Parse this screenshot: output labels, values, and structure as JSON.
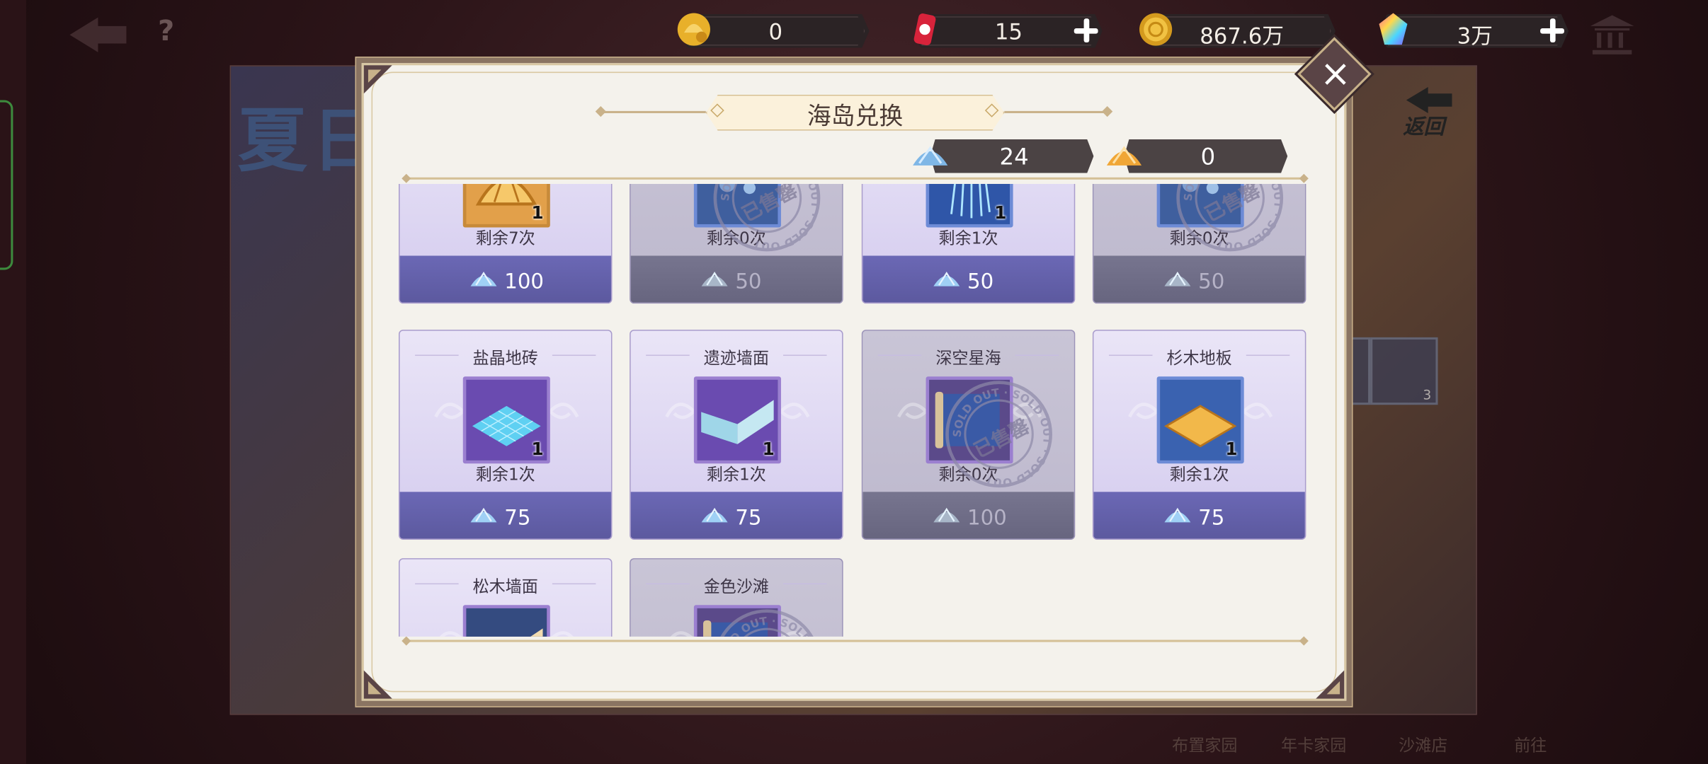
{
  "resources": [
    {
      "name": "golden-shell-currency",
      "value": "0",
      "plus": false
    },
    {
      "name": "energy-can",
      "value": "15",
      "plus": true
    },
    {
      "name": "gold-coin",
      "value": "867.6万",
      "plus": false
    },
    {
      "name": "rainbow-gem",
      "value": "3万",
      "plus": true
    }
  ],
  "background": {
    "title": "夏日",
    "return_label": "返回",
    "bottom_labels": [
      "布置家园",
      "年卡家园",
      "沙滩店",
      "前往"
    ],
    "side_slot_qty": "3"
  },
  "modal": {
    "title": "海岛兑换",
    "blue_shell_count": "24",
    "gold_shell_count": "0",
    "close_label": "×"
  },
  "stamp": {
    "text": "已售罄",
    "ring": "SOLD OUT"
  },
  "items": [
    {
      "name": "",
      "qty": "1",
      "remain": "剩余7次",
      "price": "100",
      "sold": false,
      "art": "gold-shell",
      "row": 0,
      "col": 0
    },
    {
      "name": "",
      "qty": "",
      "remain": "剩余0次",
      "price": "50",
      "sold": true,
      "art": "blue",
      "row": 0,
      "col": 1
    },
    {
      "name": "",
      "qty": "1",
      "remain": "剩余1次",
      "price": "50",
      "sold": false,
      "art": "jellyfish",
      "row": 0,
      "col": 2
    },
    {
      "name": "",
      "qty": "",
      "remain": "剩余0次",
      "price": "50",
      "sold": true,
      "art": "blue",
      "row": 0,
      "col": 3
    },
    {
      "name": "盐晶地砖",
      "qty": "1",
      "remain": "剩余1次",
      "price": "75",
      "sold": false,
      "art": "tile-blue",
      "row": 1,
      "col": 0
    },
    {
      "name": "遗迹墙面",
      "qty": "1",
      "remain": "剩余1次",
      "price": "75",
      "sold": false,
      "art": "wall",
      "row": 1,
      "col": 1
    },
    {
      "name": "深空星海",
      "qty": "",
      "remain": "剩余0次",
      "price": "100",
      "sold": true,
      "art": "scroll",
      "row": 1,
      "col": 2
    },
    {
      "name": "杉木地板",
      "qty": "1",
      "remain": "剩余1次",
      "price": "75",
      "sold": false,
      "art": "tile-gold",
      "row": 1,
      "col": 3
    },
    {
      "name": "松木墙面",
      "qty": "",
      "remain": "",
      "price": "",
      "sold": false,
      "art": "wall-wood",
      "row": 2,
      "col": 0
    },
    {
      "name": "金色沙滩",
      "qty": "",
      "remain": "",
      "price": "",
      "sold": true,
      "art": "scroll",
      "row": 2,
      "col": 1
    }
  ],
  "colors": {
    "accent": "#5c599f",
    "panel": "#f4f2ec",
    "gold_line": "#c9b28a"
  }
}
